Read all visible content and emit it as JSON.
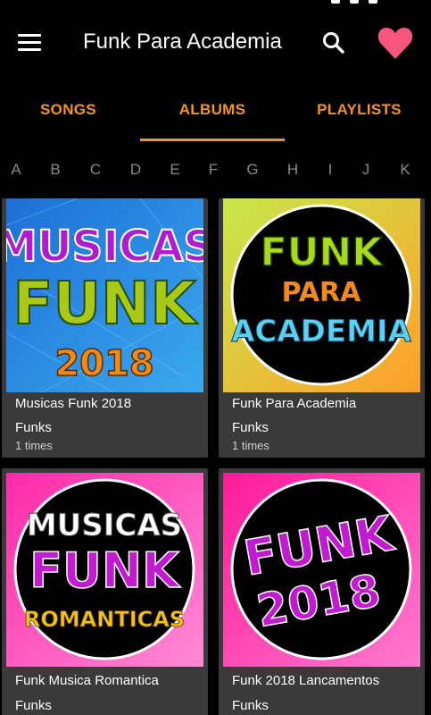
{
  "app_bar": {
    "title": "Funk Para Academia",
    "menu_icon": "menu-icon",
    "search_icon": "search-icon",
    "favorite_icon": "heart-icon",
    "favorite_color": "#f7547e"
  },
  "tabs": [
    {
      "label": "SONGS",
      "selected": false
    },
    {
      "label": "ALBUMS",
      "selected": true
    },
    {
      "label": "PLAYLISTS",
      "selected": false
    }
  ],
  "accent_color": "#f7931e",
  "alphabet": [
    "A",
    "B",
    "C",
    "D",
    "E",
    "F",
    "G",
    "H",
    "I",
    "J",
    "K"
  ],
  "albums": [
    {
      "title": "Musicas Funk 2018",
      "artist": "Funks",
      "plays": "1 times",
      "art_lines": [
        "MUSICAS",
        "FUNK",
        "2018"
      ]
    },
    {
      "title": "Funk Para Academia",
      "artist": "Funks",
      "plays": "1 times",
      "art_lines": [
        "FUNK",
        "PARA",
        "ACADEMIA"
      ]
    },
    {
      "title": "Funk Musica Romantica",
      "artist": "Funks",
      "plays": "",
      "art_lines": [
        "MUSICAS",
        "FUNK",
        "ROMANTICAS"
      ]
    },
    {
      "title": "Funk 2018  Lancamentos",
      "artist": "Funks",
      "plays": "",
      "art_lines": [
        "FUNK",
        "2018"
      ]
    }
  ]
}
